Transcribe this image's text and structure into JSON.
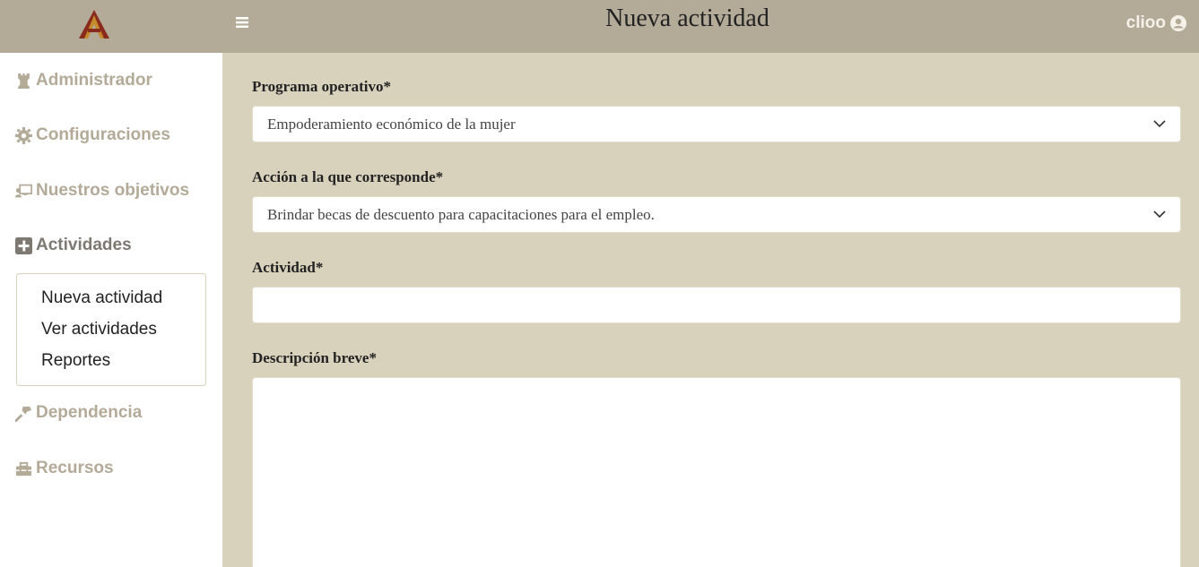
{
  "header": {
    "title": "Nueva actividad",
    "username": "clioo",
    "logo_letter": "A",
    "colors": {
      "bar": "#b3aa98",
      "logo_red": "#8a2a1c",
      "logo_gold": "#c48a2c"
    }
  },
  "sidebar": {
    "items": [
      {
        "label": "Administrador",
        "icon": "chess-rook-icon"
      },
      {
        "label": "Configuraciones",
        "icon": "gear-icon"
      },
      {
        "label": "Nuestros objetivos",
        "icon": "chalkboard-teacher-icon"
      },
      {
        "label": "Actividades",
        "icon": "plus-square-icon"
      },
      {
        "label": "Dependencia",
        "icon": "hammer-icon"
      },
      {
        "label": "Recursos",
        "icon": "toolbox-icon"
      }
    ],
    "submenu": [
      "Nueva actividad",
      "Ver actividades",
      "Reportes"
    ]
  },
  "form": {
    "programa_label": "Programa operativo*",
    "programa_value": "Empoderamiento económico de la mujer",
    "accion_label": "Acción a la que corresponde*",
    "accion_value": "Brindar becas de descuento para capacitaciones para el empleo.",
    "actividad_label": "Actividad*",
    "actividad_value": "",
    "descripcion_label": "Descripción breve*",
    "descripcion_value": ""
  }
}
